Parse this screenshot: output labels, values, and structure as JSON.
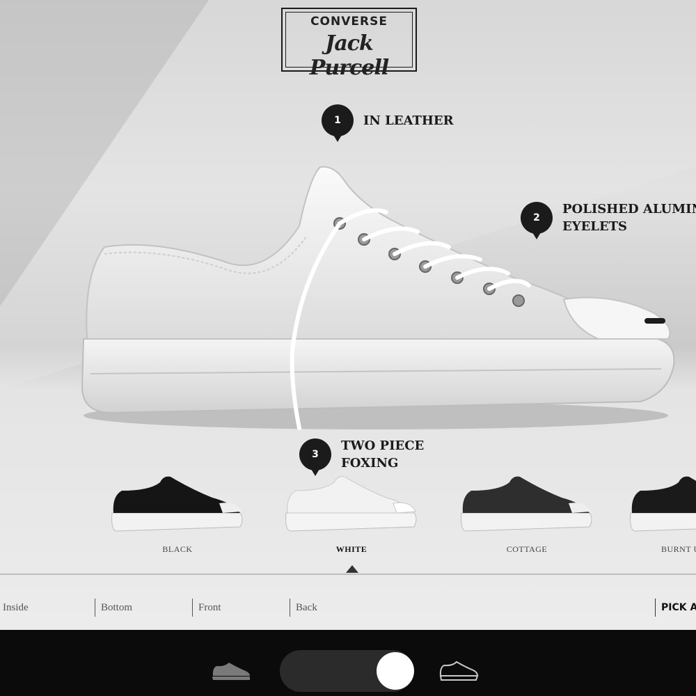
{
  "logo": {
    "brand": "CONVERSE",
    "script": "Jack Purcell"
  },
  "hotspots": [
    {
      "number": "1",
      "label": "IN LEATHER"
    },
    {
      "number": "2",
      "label": "POLISHED ALUMINU\nEYELETS"
    },
    {
      "number": "3",
      "label": "TWO PIECE\nFOXING"
    }
  ],
  "colorways": [
    {
      "label": "BLACK",
      "color": "#151515",
      "selected": false
    },
    {
      "label": "WHITE",
      "color": "#f2f2f2",
      "selected": true
    },
    {
      "label": "COTTAGE",
      "color": "#2e2e2e",
      "selected": false
    },
    {
      "label": "BURNT U",
      "color": "#1a1a1a",
      "selected": false
    }
  ],
  "views": [
    "Inside",
    "Bottom",
    "Front",
    "Back"
  ],
  "pick_label": "PICK A",
  "bottom_bar": {
    "left_icon": "sneaker-filled-icon",
    "right_icon": "sneaker-outline-icon",
    "toggle": "on"
  },
  "colors": {
    "bar": "#0b0b0b",
    "pin": "#1b1b1b",
    "knob": "#ffffff"
  }
}
